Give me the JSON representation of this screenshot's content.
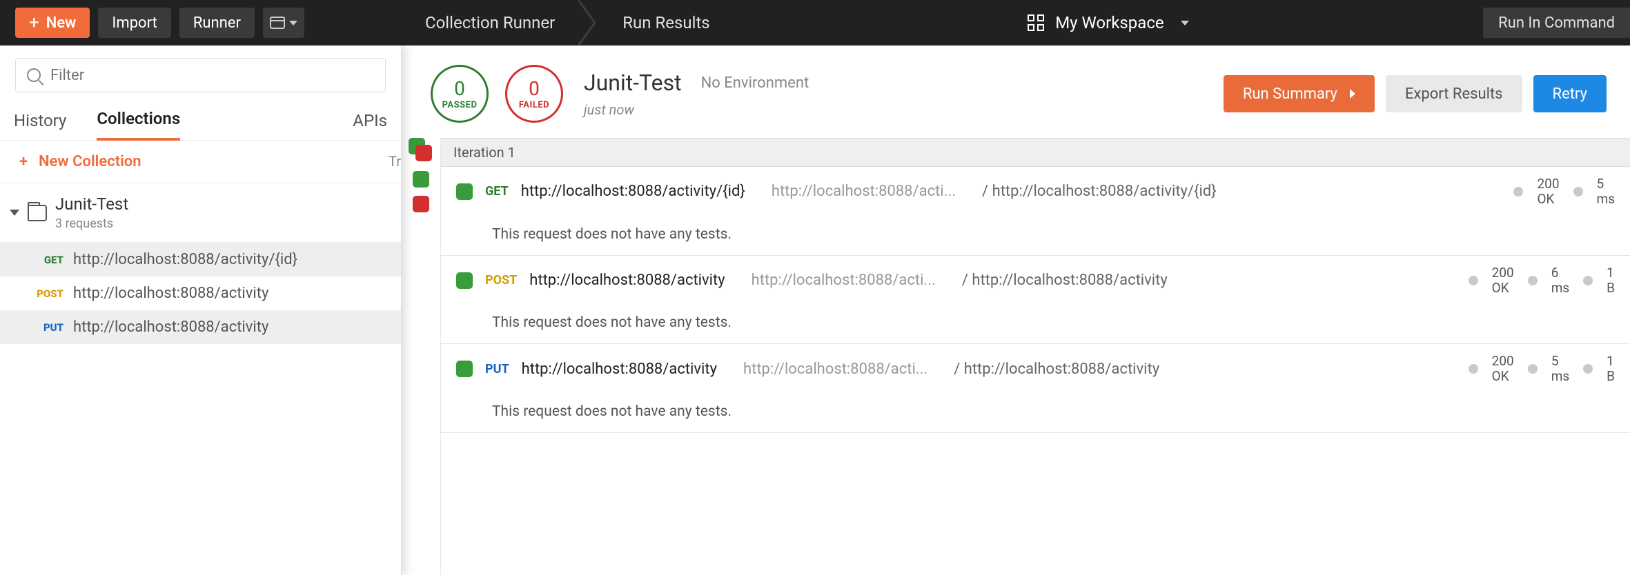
{
  "topbar": {
    "new_label": "New",
    "import_label": "Import",
    "runner_label": "Runner",
    "run_in_cmd": "Run In Command"
  },
  "breadcrumb": {
    "a": "Collection Runner",
    "b": "Run Results"
  },
  "workspace": {
    "label": "My Workspace"
  },
  "sidebar": {
    "filter_placeholder": "Filter",
    "tabs": {
      "history": "History",
      "collections": "Collections",
      "apis": "APIs"
    },
    "new_collection": "New Collection",
    "clipped": "Tr",
    "collection": {
      "name": "Junit-Test",
      "subtitle": "3 requests",
      "requests": [
        {
          "method": "GET",
          "method_class": "m-get",
          "url": "http://localhost:8088/activity/{id}",
          "hl": true
        },
        {
          "method": "POST",
          "method_class": "m-post",
          "url": "http://localhost:8088/activity",
          "hl": false
        },
        {
          "method": "PUT",
          "method_class": "m-put",
          "url": "http://localhost:8088/activity",
          "hl": true
        }
      ]
    }
  },
  "run": {
    "passed": {
      "count": "0",
      "label": "PASSED"
    },
    "failed": {
      "count": "0",
      "label": "FAILED"
    },
    "title": "Junit-Test",
    "environment": "No Environment",
    "time": "just now",
    "buttons": {
      "summary": "Run Summary",
      "export": "Export Results",
      "retry": "Retry"
    }
  },
  "results": {
    "iteration_label": "Iteration 1",
    "no_tests_msg": "This request does not have any tests.",
    "rows": [
      {
        "method": "GET",
        "method_class": "m-get",
        "url": "http://localhost:8088/activity/{id}",
        "url_trunc": "http://localhost:8088/acti...",
        "path": "/ http://localhost:8088/activity/{id}",
        "status_a": "200",
        "status_b": "OK",
        "time_a": "5",
        "time_b": "ms",
        "size_a": "",
        "size_b": ""
      },
      {
        "method": "POST",
        "method_class": "m-post",
        "url": "http://localhost:8088/activity",
        "url_trunc": "http://localhost:8088/acti...",
        "path": "/ http://localhost:8088/activity",
        "status_a": "200",
        "status_b": "OK",
        "time_a": "6",
        "time_b": "ms",
        "size_a": "1",
        "size_b": "B"
      },
      {
        "method": "PUT",
        "method_class": "m-put",
        "url": "http://localhost:8088/activity",
        "url_trunc": "http://localhost:8088/acti...",
        "path": "/ http://localhost:8088/activity",
        "status_a": "200",
        "status_b": "OK",
        "time_a": "5",
        "time_b": "ms",
        "size_a": "1",
        "size_b": "B"
      }
    ]
  }
}
